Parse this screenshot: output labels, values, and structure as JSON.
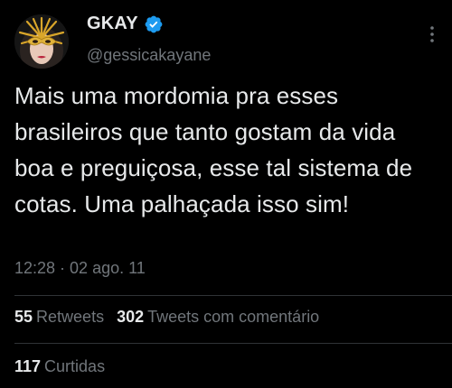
{
  "user": {
    "display_name": "GKAY",
    "handle": "@gessicakayane",
    "avatar_icon": "avatar-gold-mask",
    "verified_icon": "verified-badge-icon",
    "verified_color": "#1d9bf0"
  },
  "tweet": {
    "text": "Mais uma mordomia pra esses brasileiros que tanto gostam da vida boa e preguiçosa, esse tal sistema de cotas. Uma palhaçada isso sim!",
    "timestamp": "12:28 · 02 ago. 11"
  },
  "stats": {
    "retweets_count": "55",
    "retweets_label": "Retweets",
    "quotes_count": "302",
    "quotes_label": "Tweets com comentário",
    "likes_count": "117",
    "likes_label": "Curtidas"
  },
  "colors": {
    "background": "#000000",
    "primary_text": "#e7e9ea",
    "secondary_text": "#71767b",
    "divider": "#2f3336"
  }
}
